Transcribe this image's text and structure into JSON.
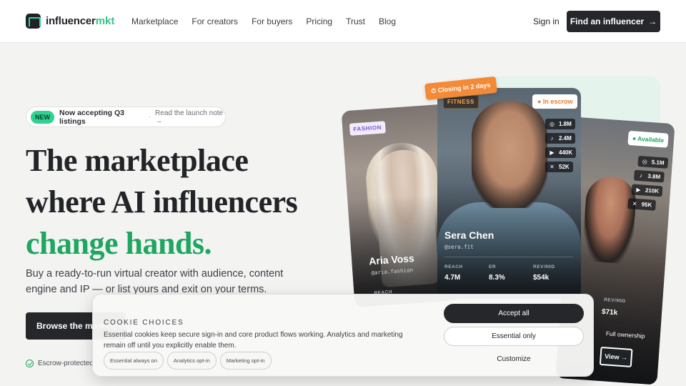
{
  "brand": {
    "name": "influencer",
    "accent": "mkt"
  },
  "nav": {
    "links": [
      "Marketplace",
      "For creators",
      "For buyers",
      "Pricing",
      "Trust",
      "Blog"
    ],
    "signin": "Sign in",
    "cta": "Find an influencer",
    "cta_icon": "arrow-right-icon"
  },
  "hero": {
    "pill_badge": "NEW",
    "pill_text": "Now accepting Q3 listings",
    "pill_link": "Read the launch note →",
    "title_line1": "The marketplace",
    "title_line2": "where AI influencers",
    "title_accent": "change hands.",
    "subtitle": "Buy a ready-to-run virtual creator with audience, content engine and IP — or list yours and exit on your terms.",
    "browse_button": "Browse the marketplace",
    "escrow_note": "Escrow-protected"
  },
  "cards": {
    "closing_badge": "⏱ Closing in 2 days",
    "aria": {
      "tag": "FASHION",
      "name": "Aria Voss",
      "handle": "@aria.fashion",
      "reach_label": "REACH"
    },
    "sera": {
      "tag": "FITNESS",
      "status": "● In escrow",
      "name": "Sera Chen",
      "handle": "@sera.fit",
      "stats": {
        "instagram": "1.8M",
        "tiktok": "2.4M",
        "youtube": "440K",
        "x": "52K"
      },
      "metrics": [
        {
          "label": "REACH",
          "value": "4.7M"
        },
        {
          "label": "ER",
          "value": "8.3%"
        },
        {
          "label": "REV/90D",
          "value": "$54k"
        }
      ]
    },
    "third": {
      "status": "● Available",
      "stats": {
        "instagram": "5.1M",
        "tiktok": "3.8M",
        "youtube": "210K",
        "x": "95K"
      },
      "rev_label": "REV/90D",
      "rev_value": "$71k",
      "ownership": "Full ownership",
      "view_button": "View →"
    }
  },
  "cookie": {
    "title": "COOKIE CHOICES",
    "text": "Essential cookies keep secure sign-in and core product flows working. Analytics and marketing remain off until you explicitly enable them.",
    "chips": [
      "Essential always on",
      "Analytics opt-in",
      "Marketing opt-in"
    ],
    "accept": "Accept all",
    "essential": "Essential only",
    "customize": "Customize"
  },
  "colors": {
    "accent_green": "#1fa660",
    "badge_green": "#2fd391",
    "orange": "#f28a38",
    "dark": "#25272a"
  }
}
